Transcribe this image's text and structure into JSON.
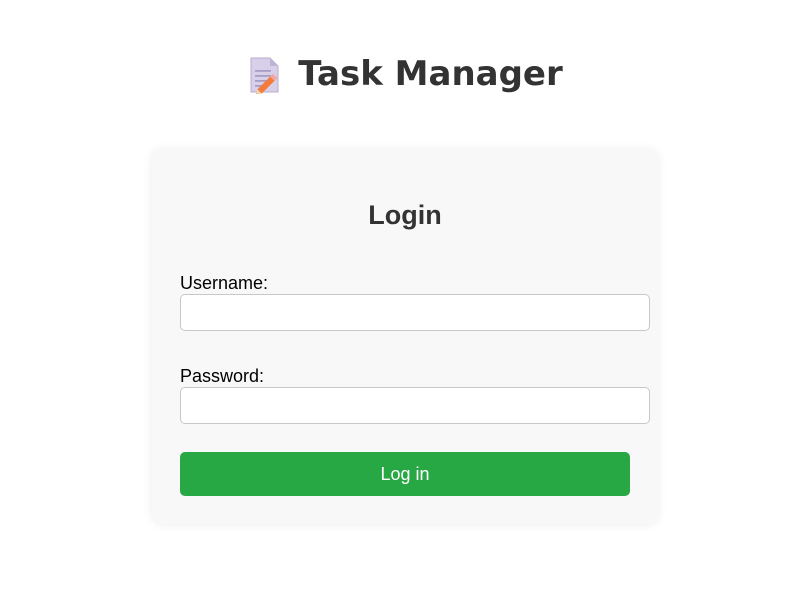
{
  "app": {
    "title": "Task Manager",
    "icon": "memo-icon"
  },
  "login": {
    "heading": "Login",
    "username_label": "Username:",
    "username_value": "",
    "password_label": "Password:",
    "password_value": "",
    "submit_label": "Log in"
  },
  "colors": {
    "accent": "#28a745",
    "card_background": "#f8f8f8",
    "title_text": "#333333"
  }
}
